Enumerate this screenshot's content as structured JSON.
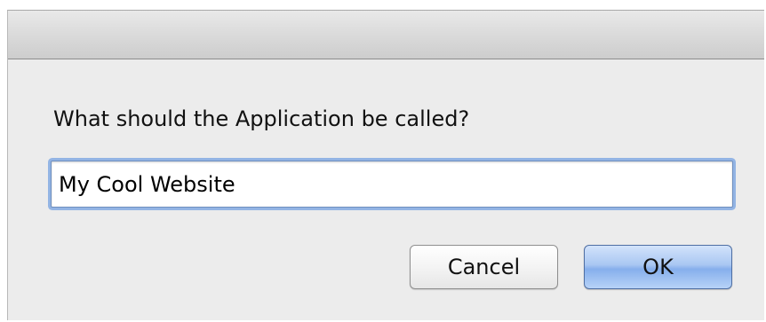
{
  "dialog": {
    "prompt": "What should the Application be called?",
    "input_value": "My Cool Website",
    "cancel_label": "Cancel",
    "ok_label": "OK"
  },
  "colors": {
    "focus_ring": "#93b4e4",
    "default_button": "#86afec",
    "window_background": "#ececec"
  }
}
